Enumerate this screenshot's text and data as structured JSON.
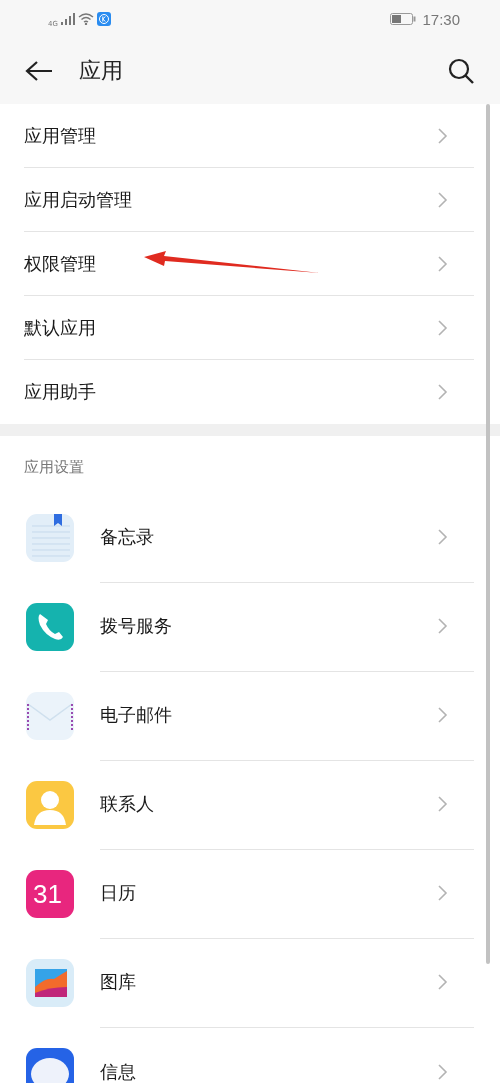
{
  "status_bar": {
    "network": "4G",
    "time": "17:30"
  },
  "header": {
    "title": "应用"
  },
  "menu": [
    {
      "label": "应用管理"
    },
    {
      "label": "应用启动管理"
    },
    {
      "label": "权限管理",
      "annotated": true
    },
    {
      "label": "默认应用"
    },
    {
      "label": "应用助手"
    }
  ],
  "section": {
    "title": "应用设置",
    "apps": [
      {
        "name": "备忘录",
        "kind": "notes"
      },
      {
        "name": "拨号服务",
        "kind": "phone"
      },
      {
        "name": "电子邮件",
        "kind": "mail"
      },
      {
        "name": "联系人",
        "kind": "contacts"
      },
      {
        "name": "日历",
        "kind": "calendar",
        "icon_text": "31"
      },
      {
        "name": "图库",
        "kind": "gallery"
      },
      {
        "name": "信息",
        "kind": "messages"
      }
    ]
  }
}
